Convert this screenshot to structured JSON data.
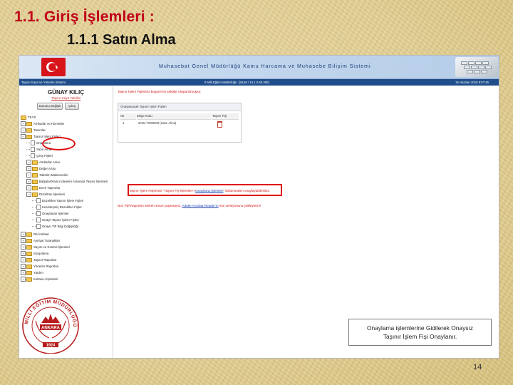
{
  "slide": {
    "title": "1.1. Giriş İşlemleri :",
    "subtitle": "1.1.1 Satın Alma",
    "page_number": "14",
    "callout_line1": "Onaylama işlemlerine Gidilerek Onaysız",
    "callout_line2": "Taşınır İşlem Fişi Onaylanır."
  },
  "app": {
    "title": "Muhasebat Genel Müdürlüğü Kamu Harcama ve Muhasebe Bilişim Sistemi",
    "status_left": "Taşınır Kayıt ve Yönetim Sistemi",
    "status_center": "Il Milli Eğitim Müdürlüğü : [6158 / 13.1.0.65.390]",
    "status_right": "15 Haziran 2015 9:07:45"
  },
  "sidebar": {
    "user_name": "GÜNAY KILIÇ",
    "user_link": "Taşınır Kayıt Yetkilisi",
    "buttons": [
      "Durumu Değiştir",
      "Çıkış"
    ],
    "tree": [
      {
        "label": "TKYS",
        "type": "root"
      },
      {
        "label": "Ambarlar ve Hizmetler",
        "type": "folder"
      },
      {
        "label": "Tanımlar",
        "type": "folder"
      },
      {
        "label": "Taşınır İşlem Fişleri",
        "type": "folder-open"
      },
      {
        "label": "Onaylama",
        "type": "doc"
      },
      {
        "label": "Satın Alma",
        "type": "doc"
      },
      {
        "label": "Çıkış Fişleri",
        "type": "doc"
      },
      {
        "label": "Ambarlar Arası",
        "type": "folder"
      },
      {
        "label": "Değer Artışı",
        "type": "folder"
      },
      {
        "label": "Tüketim Malzemeleri",
        "type": "folder"
      },
      {
        "label": "Bağışlar/Kamu İdareleri Arasında Taşınır İşlemleri",
        "type": "folder"
      },
      {
        "label": "Devir Taşınırlar",
        "type": "folder"
      },
      {
        "label": "Düzeltme İşlemleri",
        "type": "folder"
      },
      {
        "label": "Düzeltilen Taşınır İşlem Fişleri",
        "type": "doc"
      },
      {
        "label": "Kesinleşmiş Düzeltilen Fişler",
        "type": "doc"
      },
      {
        "label": "Onaylanan İşlemler",
        "type": "doc"
      },
      {
        "label": "Onaylı Taşınır İşlem Fişleri",
        "type": "doc"
      },
      {
        "label": "Onaylı TİF Bilgi Değişikliği",
        "type": "doc"
      },
      {
        "label": "Raf Ambarı",
        "type": "folder"
      },
      {
        "label": "Ayniyat Tutanakları",
        "type": "folder"
      },
      {
        "label": "Sayım ve Kontrol İşlemleri",
        "type": "folder"
      },
      {
        "label": "Sorgulama",
        "type": "folder"
      },
      {
        "label": "Taşınır Raporları",
        "type": "folder"
      },
      {
        "label": "Yönetim Raporları",
        "type": "folder"
      },
      {
        "label": "Yardım",
        "type": "folder"
      },
      {
        "label": "Kullanıcı İşlemleri",
        "type": "folder"
      }
    ]
  },
  "main": {
    "msg_top": "Taşınır İşlem Fişleriniz başarılı bir şekilde oluşturulmuştur.",
    "panel_title": "Onaylanacak Taşınır İşlem Fişleri",
    "columns": [
      "No",
      "Belge Kodu",
      "Taşınır Fişi"
    ],
    "rows": [
      {
        "no": "1",
        "code": "2015 / 0000003 (Satın Alma)"
      }
    ],
    "msg_mid_pre": "Taşınır İşlem Fişlerinizi \"Taşınır Fiş İşlemleri->",
    "msg_mid_link": "Onaylama İşlemleri",
    "msg_mid_post": "\" bölümünden onaylayabilirsiniz.",
    "msg_bottom_pre": "Not: Pdf Raporları alırken sorun yaşarsanız,",
    "msg_bottom_link": "Adobe Acrobat Reader'ın",
    "msg_bottom_post": "son versiyonunu yükleyiniz!!!"
  },
  "seal": {
    "text_arc": "MİLLİ EĞİTİM MÜDÜRLÜĞÜ",
    "center": "ANKARA",
    "year": "1924"
  },
  "colors": {
    "title_red": "#c0001a",
    "header_blue": "#1c3f7a",
    "status_bar": "#1f4d8c",
    "highlight_red": "#e01010"
  }
}
